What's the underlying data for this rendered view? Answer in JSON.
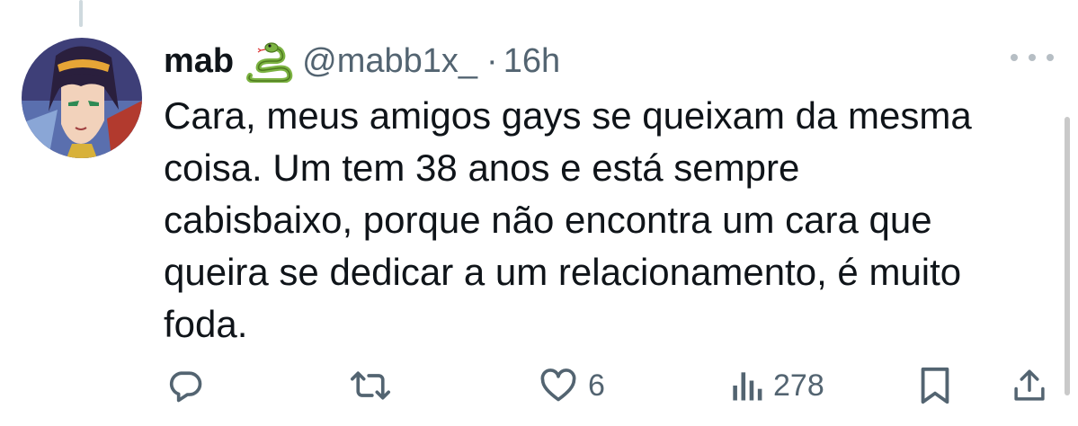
{
  "tweet": {
    "display_name": "mab",
    "name_emoji": "snake-emoji",
    "handle": "@mabb1x_",
    "separator": "·",
    "time": "16h",
    "text": "Cara, meus amigos gays se queixam da mesma\ncoisa. Um tem 38 anos e está sempre\ncabisbaixo, porque não encontra um cara que\nqueira se dedicar a um relacionamento, é muito\nfoda."
  },
  "actions": {
    "reply": {
      "icon": "reply-icon",
      "count": ""
    },
    "retweet": {
      "icon": "retweet-icon",
      "count": ""
    },
    "like": {
      "icon": "heart-icon",
      "count": "6"
    },
    "views": {
      "icon": "views-icon",
      "count": "278"
    },
    "bookmark": {
      "icon": "bookmark-icon"
    },
    "share": {
      "icon": "share-icon"
    }
  },
  "colors": {
    "text": "#0f1419",
    "secondary": "#536471",
    "icon": "#536471",
    "snake_green": "#7cb342",
    "thread_line": "#cfd9de"
  }
}
